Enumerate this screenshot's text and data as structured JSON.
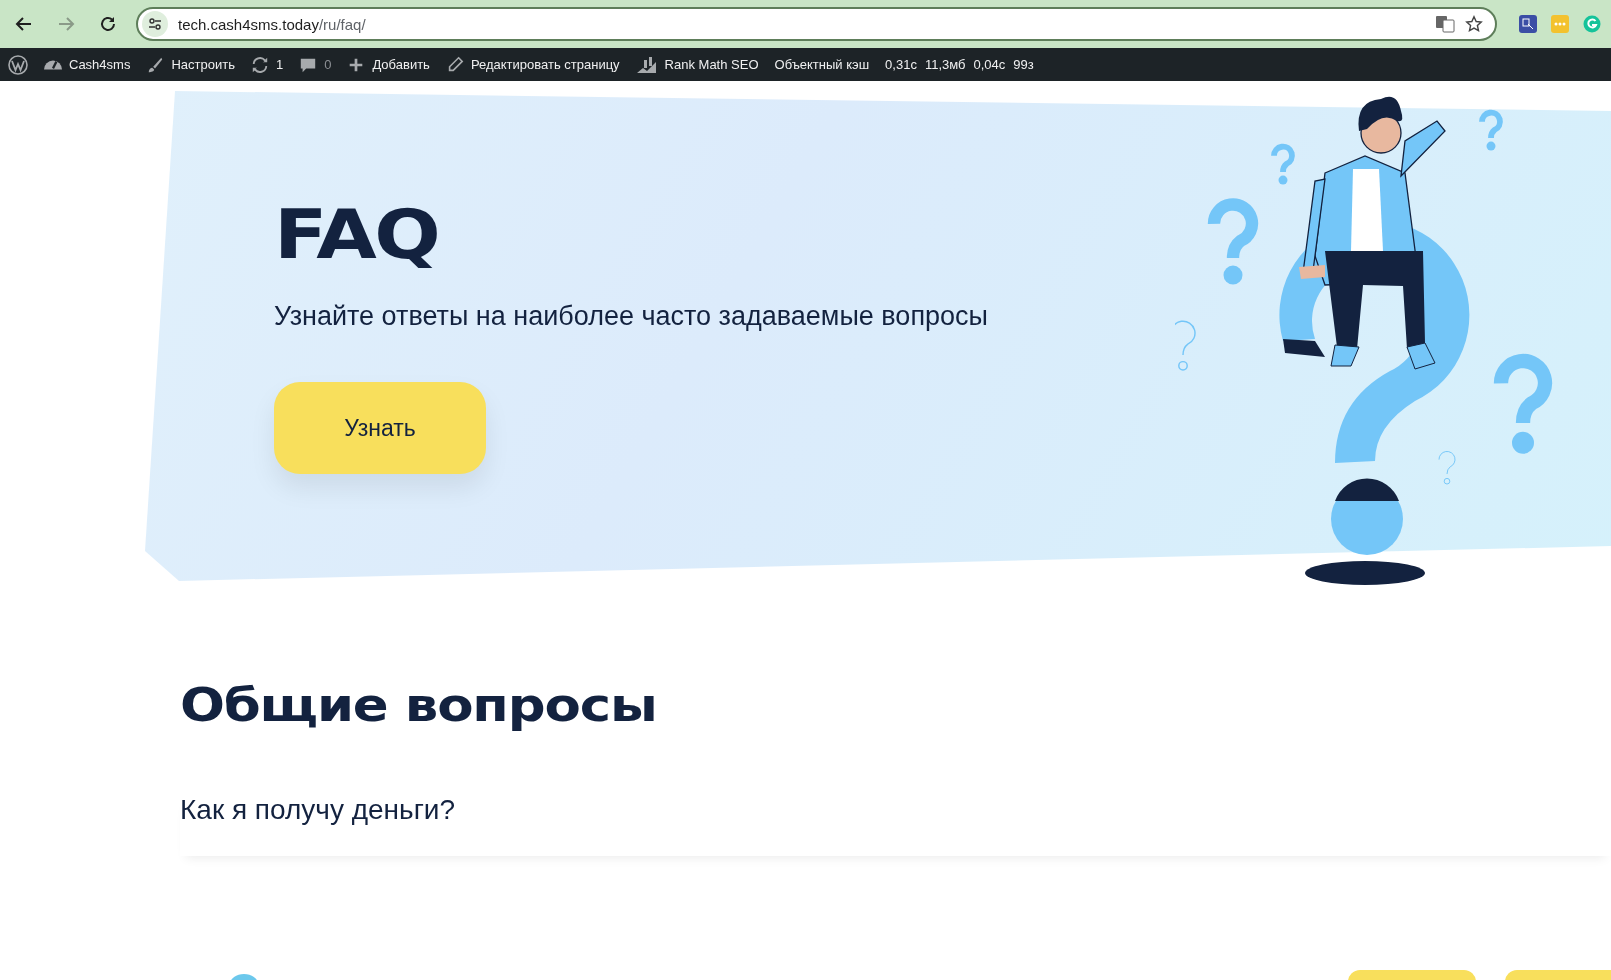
{
  "browser": {
    "url": {
      "host": "tech.cash4sms.today",
      "path": "/ru/faq/"
    }
  },
  "admin_bar": [
    {
      "kind": "logo"
    },
    {
      "kind": "site",
      "label": "Cash4sms"
    },
    {
      "kind": "customize",
      "label": "Настроить"
    },
    {
      "kind": "updates",
      "label": "1"
    },
    {
      "kind": "comments",
      "label": "0"
    },
    {
      "kind": "new",
      "label": "Добавить"
    },
    {
      "kind": "edit",
      "label": "Редактировать страницу"
    },
    {
      "kind": "seo",
      "label": "Rank Math SEO"
    },
    {
      "kind": "text",
      "label": "Объектный кэш"
    },
    {
      "kind": "stat",
      "label": "0,31с"
    },
    {
      "kind": "stat",
      "label": "11,3мб"
    },
    {
      "kind": "stat",
      "label": "0,04с"
    },
    {
      "kind": "stat",
      "label": "99з"
    }
  ],
  "hero": {
    "title": "FAQ",
    "subtitle": "Узнайте ответы на наиболее часто задаваемые вопросы",
    "button": "Узнать"
  },
  "section": {
    "title": "Общие вопросы",
    "questions": [
      {
        "text": "Как я получу деньги?"
      }
    ]
  }
}
